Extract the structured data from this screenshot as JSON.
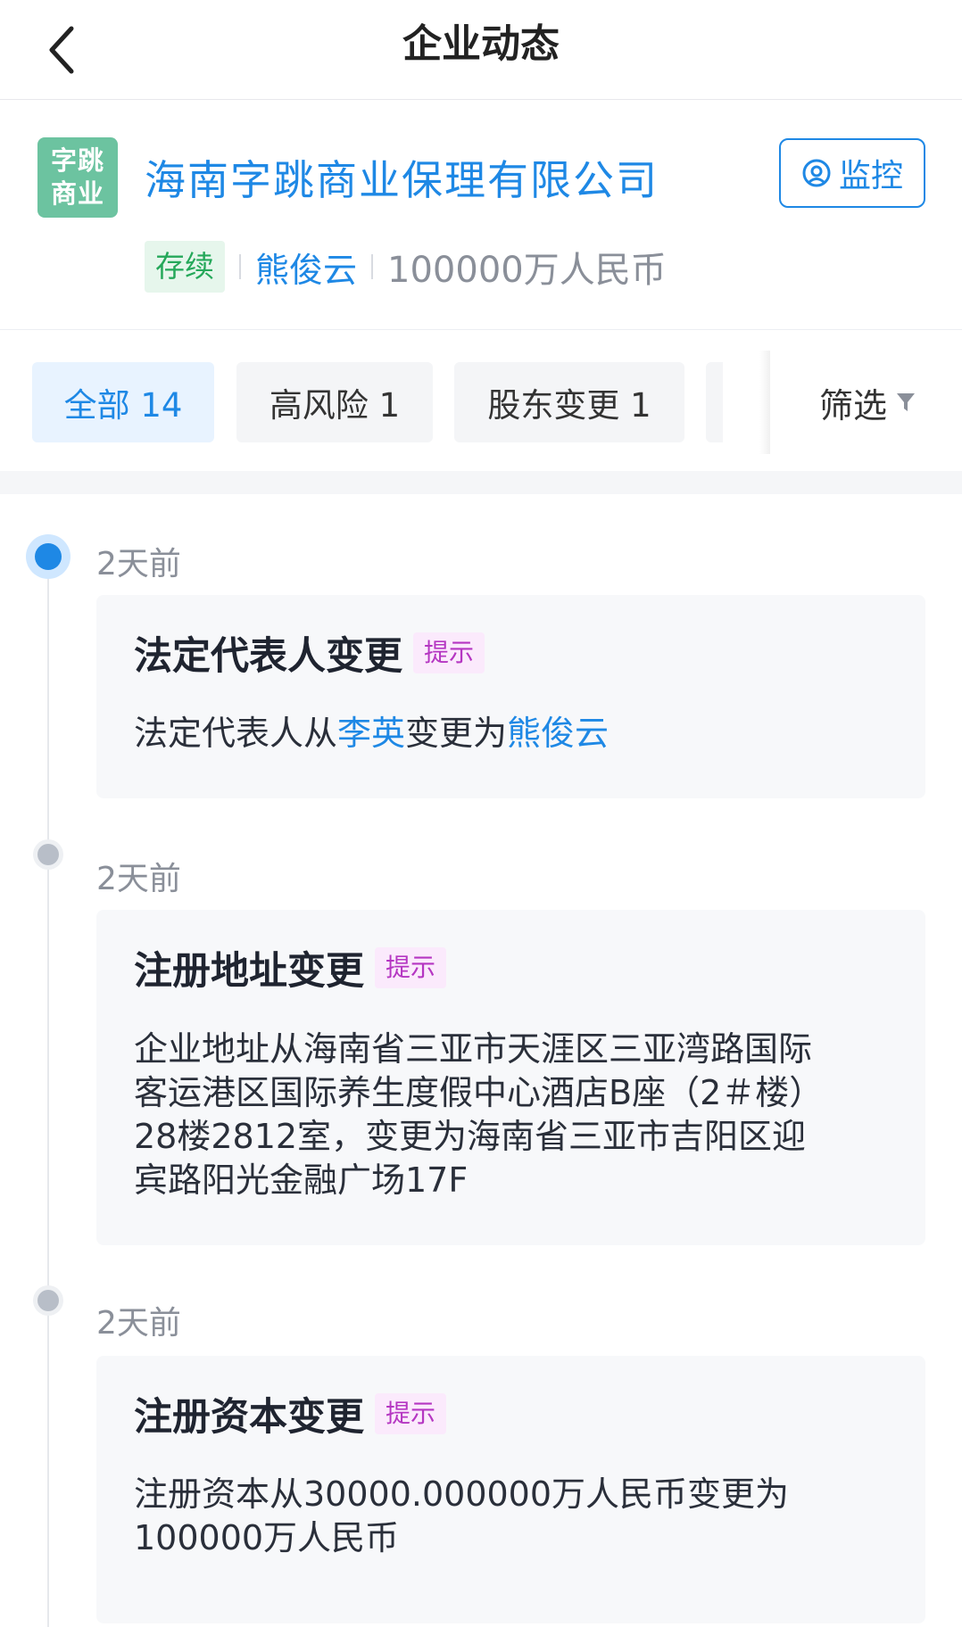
{
  "header": {
    "title": "企业动态",
    "back_icon": "chevron-left-icon"
  },
  "company": {
    "logo_line1": "字跳",
    "logo_line2": "商业",
    "logo_color": "#6cc3a0",
    "name": "海南字跳商业保理有限公司",
    "monitor_label": "监控",
    "status": "存续",
    "legal_rep": "熊俊云",
    "registered_capital": "100000万人民币"
  },
  "tabs": [
    {
      "label": "全部 14",
      "active": true
    },
    {
      "label": "高风险 1",
      "active": false
    },
    {
      "label": "股东变更 1",
      "active": false
    }
  ],
  "filter": {
    "label": "筛选",
    "icon": "funnel-icon"
  },
  "timeline": [
    {
      "time": "2天前",
      "title": "法定代表人变更",
      "tag": "提示",
      "body": {
        "prefix": "法定代表人从",
        "old_value": "李英",
        "middle": "变更为",
        "new_value": "熊俊云"
      }
    },
    {
      "time": "2天前",
      "title": "注册地址变更",
      "tag": "提示",
      "body": {
        "line1": "企业地址从海南省三亚市天涯区三亚湾路国际",
        "line2": "客运港区国际养生度假中心酒店B座（2＃楼）",
        "line3": "28楼2812室，变更为海南省三亚市吉阳区迎",
        "line4": "宾路阳光金融广场17F"
      }
    },
    {
      "time": "2天前",
      "title": "注册资本变更",
      "tag": "提示",
      "body": {
        "line1": "注册资本从30000.000000万人民币变更为",
        "line2": "100000万人民币"
      }
    }
  ],
  "colors": {
    "accent": "#1e88e5",
    "status_green": "#25a85a",
    "tag_purple": "#b536c2"
  }
}
